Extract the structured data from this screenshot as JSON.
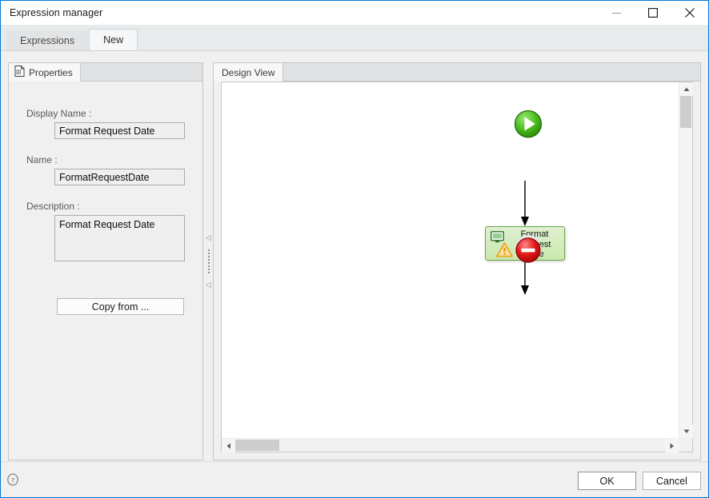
{
  "window": {
    "title": "Expression manager",
    "controls": {
      "minimize": "minimize-icon",
      "maximize": "maximize-icon",
      "close": "close-icon"
    }
  },
  "tabs": [
    {
      "label": "Expressions",
      "active": false
    },
    {
      "label": "New",
      "active": true
    }
  ],
  "properties_panel": {
    "tab_label": "Properties",
    "tab_icon": "properties-document-icon",
    "fields": [
      {
        "label": "Display Name :",
        "value": "Format Request Date",
        "placeholder": ""
      },
      {
        "label": "Name :",
        "value": "FormatRequestDate",
        "placeholder": ""
      },
      {
        "label": "Description :",
        "value": "Format Request Date",
        "placeholder": ""
      }
    ],
    "copy_from_label": "Copy from ..."
  },
  "splitter": {
    "collapse_left_icon": "triangle-left-icon",
    "grip_icon": "grip-dots-icon"
  },
  "design_panel": {
    "tab_label": "Design View",
    "flow": {
      "start_node": {
        "name": "start-node",
        "icon": "play-circle-icon"
      },
      "activity_node": {
        "name": "activity-node",
        "label": "Format\nRequest\nDate",
        "label_line1": "Format",
        "label_line2": "Request",
        "label_line3": "Date",
        "type_icon": "monitor-icon",
        "warning_icon": "warning-triangle-icon"
      },
      "stop_node": {
        "name": "stop-node",
        "icon": "stop-circle-icon"
      }
    },
    "scrollbars": {
      "v_up": "chevron-up-icon",
      "v_down": "chevron-down-icon",
      "h_left": "chevron-left-icon",
      "h_right": "chevron-right-icon"
    }
  },
  "footer": {
    "help_icon": "help-question-icon",
    "ok_label": "OK",
    "cancel_label": "Cancel"
  },
  "colors": {
    "accent": "#0078d7",
    "node_green_border": "#6aa84f",
    "node_green_fill": "#c9e8ae",
    "start_green": "#3ea91a",
    "stop_red": "#d81f1f",
    "warning_orange": "#f5a623"
  }
}
